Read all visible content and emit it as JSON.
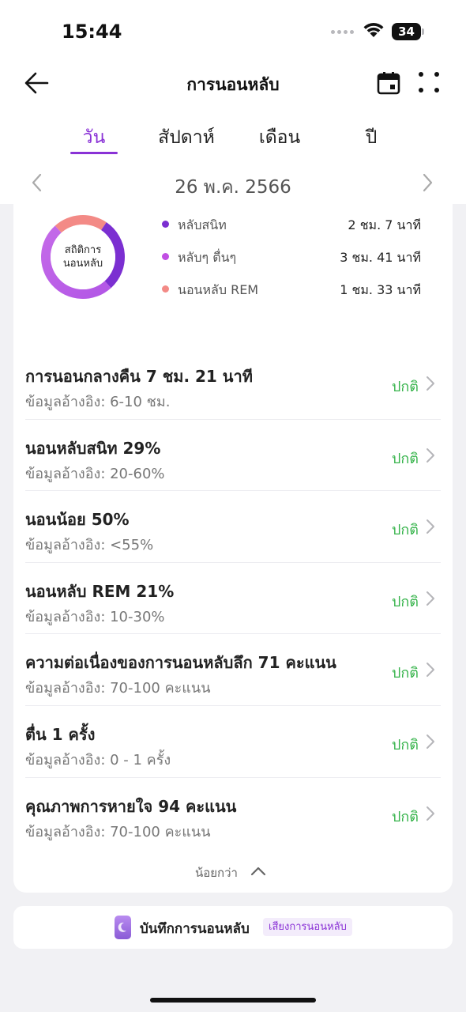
{
  "status_bar": {
    "time": "15:44",
    "battery": "34"
  },
  "header": {
    "title": "การนอนหลับ",
    "back_icon": "arrow-left-icon",
    "calendar_icon": "calendar-icon",
    "more_icon": "grid-dots-icon"
  },
  "tabs": [
    {
      "label": "วัน",
      "active": true
    },
    {
      "label": "สัปดาห์",
      "active": false
    },
    {
      "label": "เดือน",
      "active": false
    },
    {
      "label": "ปี",
      "active": false
    }
  ],
  "date_nav": {
    "date": "26 พ.ค. 2566"
  },
  "sleep_stats": {
    "donut_label_line1": "สถิติการ",
    "donut_label_line2": "นอนหลับ",
    "legend": [
      {
        "label": "หลับสนิท",
        "value": "2 ชม. 7 นาที",
        "color": "#7b2fd1"
      },
      {
        "label": "หลับๆ ตื่นๆ",
        "value": "3 ชม. 41 นาที",
        "color": "#c14fe3"
      },
      {
        "label": "นอนหลับ REM",
        "value": "1 ชม. 33 นาที",
        "color": "#f38a86"
      }
    ]
  },
  "metrics": [
    {
      "title": "การนอนกลางคืน 7 ชม. 21 นาที",
      "ref": "ข้อมูลอ้างอิง: 6-10 ชม.",
      "status": "ปกติ"
    },
    {
      "title": "นอนหลับสนิท 29%",
      "ref": "ข้อมูลอ้างอิง: 20-60%",
      "status": "ปกติ"
    },
    {
      "title": "นอนน้อย 50%",
      "ref": "ข้อมูลอ้างอิง: <55%",
      "status": "ปกติ"
    },
    {
      "title": "นอนหลับ REM 21%",
      "ref": "ข้อมูลอ้างอิง: 10-30%",
      "status": "ปกติ"
    },
    {
      "title": "ความต่อเนื่องของการนอนหลับลึก 71 คะแนน",
      "ref": "ข้อมูลอ้างอิง: 70-100 คะแนน",
      "status": "ปกติ"
    },
    {
      "title": "ตื่น 1 ครั้ง",
      "ref": "ข้อมูลอ้างอิง: 0 - 1 ครั้ง",
      "status": "ปกติ"
    },
    {
      "title": "คุณภาพการหายใจ 94 คะแนน",
      "ref": "ข้อมูลอ้างอิง: 70-100 คะแนน",
      "status": "ปกติ"
    }
  ],
  "less_label": "น้อยกว่า",
  "sleep_record": {
    "label": "บันทึกการนอนหลับ",
    "badge": "เสียงการนอนหลับ"
  },
  "colors": {
    "accent": "#8a32d6",
    "normal": "#35b34a"
  }
}
